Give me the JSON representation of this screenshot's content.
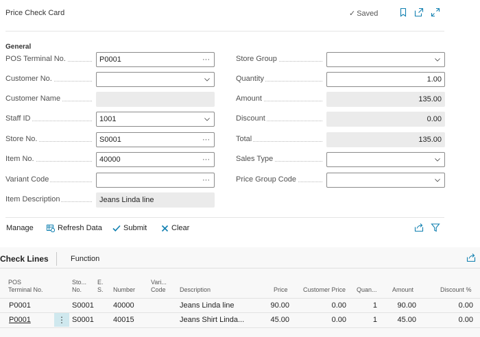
{
  "header": {
    "title": "Price Check Card",
    "saved_label": "Saved"
  },
  "general": {
    "section_title": "General",
    "left_fields": [
      {
        "label": "POS Terminal No.",
        "value": "P0001",
        "control": "lookup"
      },
      {
        "label": "Customer No.",
        "value": "",
        "control": "dropdown"
      },
      {
        "label": "Customer Name",
        "value": "",
        "control": "readonly"
      },
      {
        "label": "Staff ID",
        "value": "1001",
        "control": "dropdown"
      },
      {
        "label": "Store No.",
        "value": "S0001",
        "control": "lookup"
      },
      {
        "label": "Item No.",
        "value": "40000",
        "control": "lookup"
      },
      {
        "label": "Variant Code",
        "value": "",
        "control": "lookup"
      },
      {
        "label": "Item Description",
        "value": "Jeans Linda line",
        "control": "readonly"
      }
    ],
    "right_fields": [
      {
        "label": "Store Group",
        "value": "",
        "control": "dropdown"
      },
      {
        "label": "Quantity",
        "value": "1.00",
        "control": "number"
      },
      {
        "label": "Amount",
        "value": "135.00",
        "control": "readonly-number"
      },
      {
        "label": "Discount",
        "value": "0.00",
        "control": "readonly-number"
      },
      {
        "label": "Total",
        "value": "135.00",
        "control": "readonly-number"
      },
      {
        "label": "Sales Type",
        "value": "",
        "control": "dropdown"
      },
      {
        "label": "Price Group Code",
        "value": "",
        "control": "dropdown"
      }
    ]
  },
  "actions": {
    "manage": "Manage",
    "refresh": "Refresh Data",
    "submit": "Submit",
    "clear": "Clear"
  },
  "lines": {
    "title": "Check Lines",
    "function_label": "Function",
    "columns": [
      {
        "l1": "POS",
        "l2": "Terminal No."
      },
      {
        "l1": "Sto...",
        "l2": "No."
      },
      {
        "l1": "E.",
        "l2": "S."
      },
      {
        "l1": "",
        "l2": "Number"
      },
      {
        "l1": "Vari...",
        "l2": "Code"
      },
      {
        "l1": "",
        "l2": "Description"
      },
      {
        "l1": "",
        "l2": "Price"
      },
      {
        "l1": "",
        "l2": "Customer Price"
      },
      {
        "l1": "",
        "l2": "Quan..."
      },
      {
        "l1": "",
        "l2": "Amount"
      },
      {
        "l1": "",
        "l2": "Discount %"
      }
    ],
    "rows": [
      {
        "terminal": "P0001",
        "store": "S0001",
        "es": "",
        "number": "40000",
        "variant": "",
        "description": "Jeans Linda line",
        "price": "90.00",
        "customer_price": "0.00",
        "quantity": "1",
        "amount": "90.00",
        "discount": "0.00"
      },
      {
        "terminal": "P0001",
        "store": "S0001",
        "es": "",
        "number": "40015",
        "variant": "",
        "description": "Jeans Shirt Linda...",
        "price": "45.00",
        "customer_price": "0.00",
        "quantity": "1",
        "amount": "45.00",
        "discount": "0.00"
      }
    ]
  },
  "colors": {
    "accent": "#0f7fb0",
    "selected_row_marker": "#cfe8ee",
    "readonly_field": "#ebebeb"
  }
}
